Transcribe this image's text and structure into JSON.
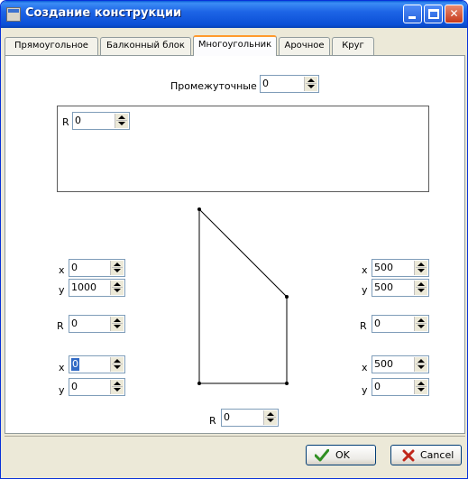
{
  "window": {
    "title": "Создание конструкции",
    "minimize_glyph": "_",
    "maximize_glyph": "□",
    "close_glyph": "✕"
  },
  "tabs": [
    {
      "label": "Прямоугольное"
    },
    {
      "label": "Балконный блок"
    },
    {
      "label": "Многоугольник"
    },
    {
      "label": "Арочное"
    },
    {
      "label": "Круг"
    }
  ],
  "active_tab": "Многоугольник",
  "intermediate": {
    "label": "Промежуточные",
    "value": "0"
  },
  "rbox": {
    "label": "R",
    "value": "0"
  },
  "left": {
    "top_point": {
      "x_label": "x",
      "x_value": "0",
      "y_label": "y",
      "y_value": "1000"
    },
    "r": {
      "label": "R",
      "value": "0"
    },
    "bottom_point": {
      "x_label": "x",
      "x_value": "0",
      "y_label": "y",
      "y_value": "0"
    }
  },
  "right": {
    "top_point": {
      "x_label": "x",
      "x_value": "500",
      "y_label": "y",
      "y_value": "500"
    },
    "r": {
      "label": "R",
      "value": "0"
    },
    "bottom_point": {
      "x_label": "x",
      "x_value": "500",
      "y_label": "y",
      "y_value": "0"
    }
  },
  "bottom_r": {
    "label": "R",
    "value": "0"
  },
  "buttons": {
    "ok": "OK",
    "cancel": "Cancel"
  },
  "colors": {
    "accent": "#0b4fd6",
    "ok_check": "#2f8f22",
    "cancel_x": "#c0261a"
  }
}
